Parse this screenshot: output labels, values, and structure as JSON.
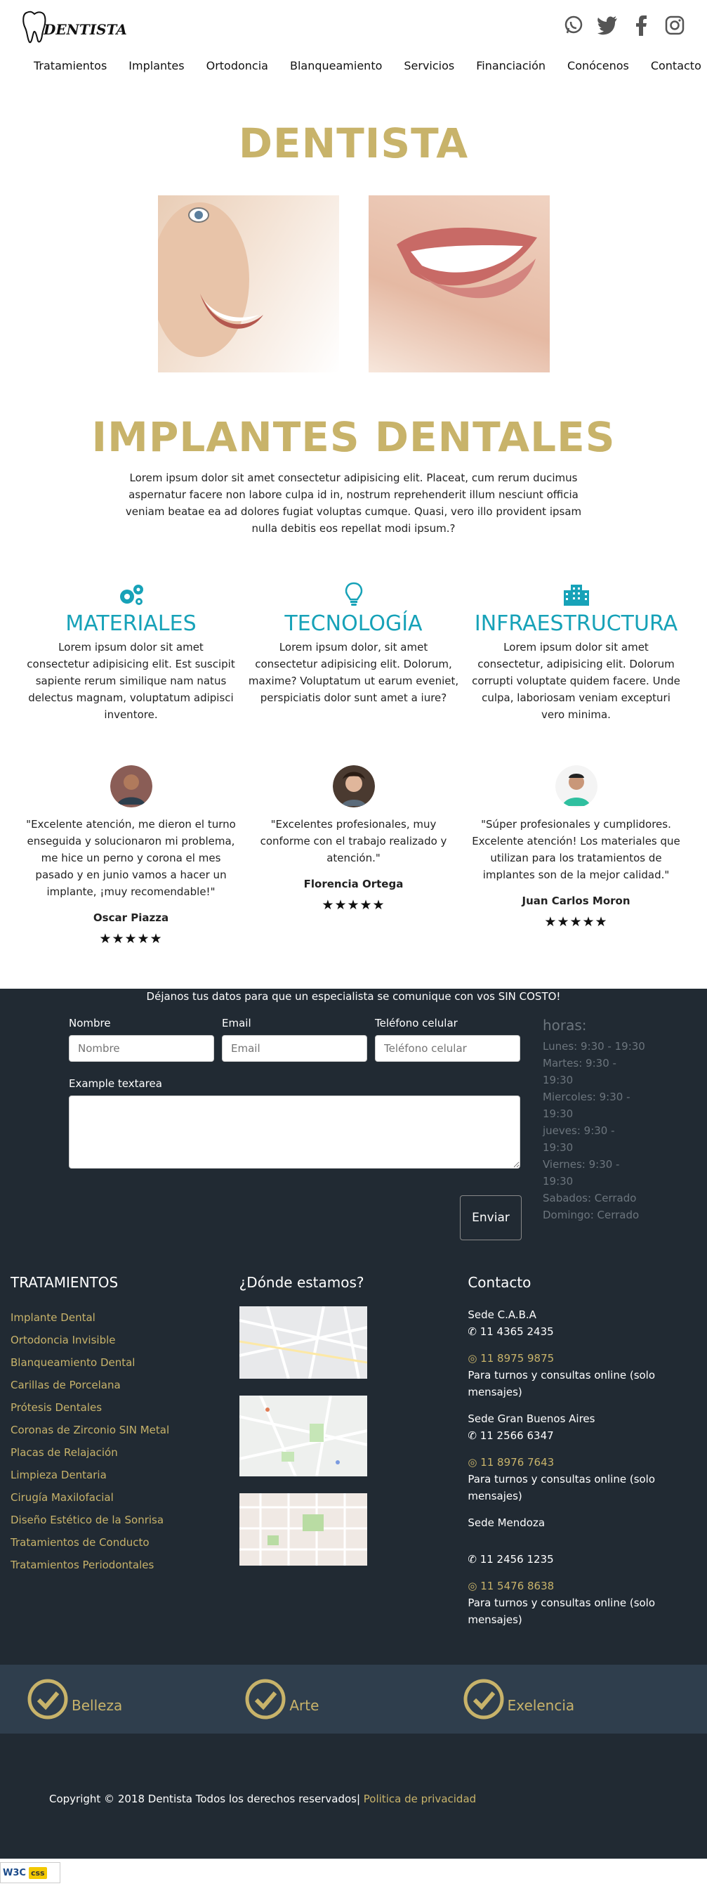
{
  "brand": {
    "name": "DENTISTA"
  },
  "nav": [
    "Tratamientos",
    "Implantes",
    "Ortodoncia",
    "Blanqueamiento",
    "Servicios",
    "Financiación",
    "Conócenos",
    "Contacto"
  ],
  "socials": [
    "whatsapp-icon",
    "twitter-icon",
    "facebook-icon",
    "instagram-icon"
  ],
  "hero": {
    "title": "DENTISTA"
  },
  "implants": {
    "title": "IMPLANTES DENTALES",
    "text": "Lorem ipsum dolor sit amet consectetur adipisicing elit. Placeat, cum rerum ducimus aspernatur facere non labore culpa id in, nostrum reprehenderit illum nesciunt officia veniam beatae ea ad dolores fugiat voluptas cumque. Quasi, vero illo provident ipsam nulla debitis eos repellat modi ipsum.?"
  },
  "features": [
    {
      "icon": "gears-icon",
      "title": "MATERIALES",
      "text": "Lorem ipsum dolor sit amet consectetur adipisicing elit. Est suscipit sapiente rerum similique nam natus delectus magnam, voluptatum adipisci inventore."
    },
    {
      "icon": "lightbulb-icon",
      "title": "TECNOLOGÍA",
      "text": "Lorem ipsum dolor, sit amet consectetur adipisicing elit. Dolorum, maxime? Voluptatum ut earum eveniet, perspiciatis dolor sunt amet a iure?"
    },
    {
      "icon": "building-icon",
      "title": "INFRAESTRUCTURA",
      "text": "Lorem ipsum dolor sit amet consectetur, adipisicing elit. Dolorum corrupti voluptate quidem facere. Unde culpa, laboriosam veniam excepturi vero minima."
    }
  ],
  "testimonials": [
    {
      "quote": "\"Excelente atención, me dieron el turno enseguida y solucionaron mi problema, me hice un perno y corona el mes pasado y en junio vamos a hacer un implante, ¡muy recomendable!\"",
      "name": "Oscar Piazza",
      "stars": "★★★★★"
    },
    {
      "quote": "\"Excelentes profesionales, muy conforme con el trabajo realizado y atención.\"",
      "name": "Florencia Ortega",
      "stars": "★★★★★"
    },
    {
      "quote": "\"Súper profesionales y cumplidores. Excelente atención! Los materiales que utilizan para los tratamientos de implantes son de la mejor calidad.\"",
      "name": "Juan Carlos Moron",
      "stars": "★★★★★"
    }
  ],
  "form": {
    "intro": "Déjanos tus datos para que un especialista se comunique con vos SIN COSTO!",
    "name_label": "Nombre",
    "name_placeholder": "Nombre",
    "email_label": "Email",
    "email_placeholder": "Email",
    "phone_label": "Teléfono celular",
    "phone_placeholder": "Teléfono celular",
    "textarea_label": "Example textarea",
    "send": "Enviar"
  },
  "hours": {
    "title": "horas:",
    "lines": [
      "Lunes: 9:30 - 19:30",
      "Martes: 9:30 - 19:30",
      "Miercoles: 9:30 - 19:30",
      "jueves: 9:30 - 19:30",
      "Viernes: 9:30 - 19:30",
      "Sabados: Cerrado",
      "Domingo: Cerrado"
    ]
  },
  "treatments": {
    "title": "TRATAMIENTOS",
    "items": [
      "Implante Dental",
      "Ortodoncia Invisible",
      "Blanqueamiento Dental",
      "Carillas de Porcelana",
      "Prótesis Dentales",
      "Coronas de Zirconio SIN Metal",
      "Placas de Relajación",
      "Limpieza Dentaria",
      "Cirugía Maxilofacial",
      "Diseño Estético de la Sonrisa",
      "Tratamientos de Conducto",
      "Tratamientos Periodontales"
    ]
  },
  "locations": {
    "title": "¿Dónde estamos?"
  },
  "contact": {
    "title": "Contacto",
    "sedes": [
      {
        "name": "Sede C.A.B.A",
        "phone": "11 4365 2435",
        "whatsapp": "11 8975 9875",
        "note": "Para turnos y consultas online (solo mensajes)"
      },
      {
        "name": "Sede Gran Buenos Aires",
        "phone": "11 2566 6347",
        "whatsapp": "11 8976 7643",
        "note": "Para turnos y consultas online (solo mensajes)"
      },
      {
        "name": "Sede Mendoza",
        "phone": "11 2456 1235",
        "whatsapp": "11 5476 8638",
        "note": "Para turnos y consultas online (solo mensajes)"
      }
    ]
  },
  "values": [
    "Belleza",
    "Arte",
    "Exelencia"
  ],
  "footer": {
    "copyright": "Copyright © 2018 Dentista Todos los derechos reservados|",
    "privacy": " Politica de privacidad"
  },
  "badge": {
    "w3c": "W3C",
    "css": "css"
  },
  "colors": {
    "gold": "#c8b36a",
    "teal": "#17a2b8",
    "dark": "#212a33",
    "band": "#2f3e4d"
  }
}
